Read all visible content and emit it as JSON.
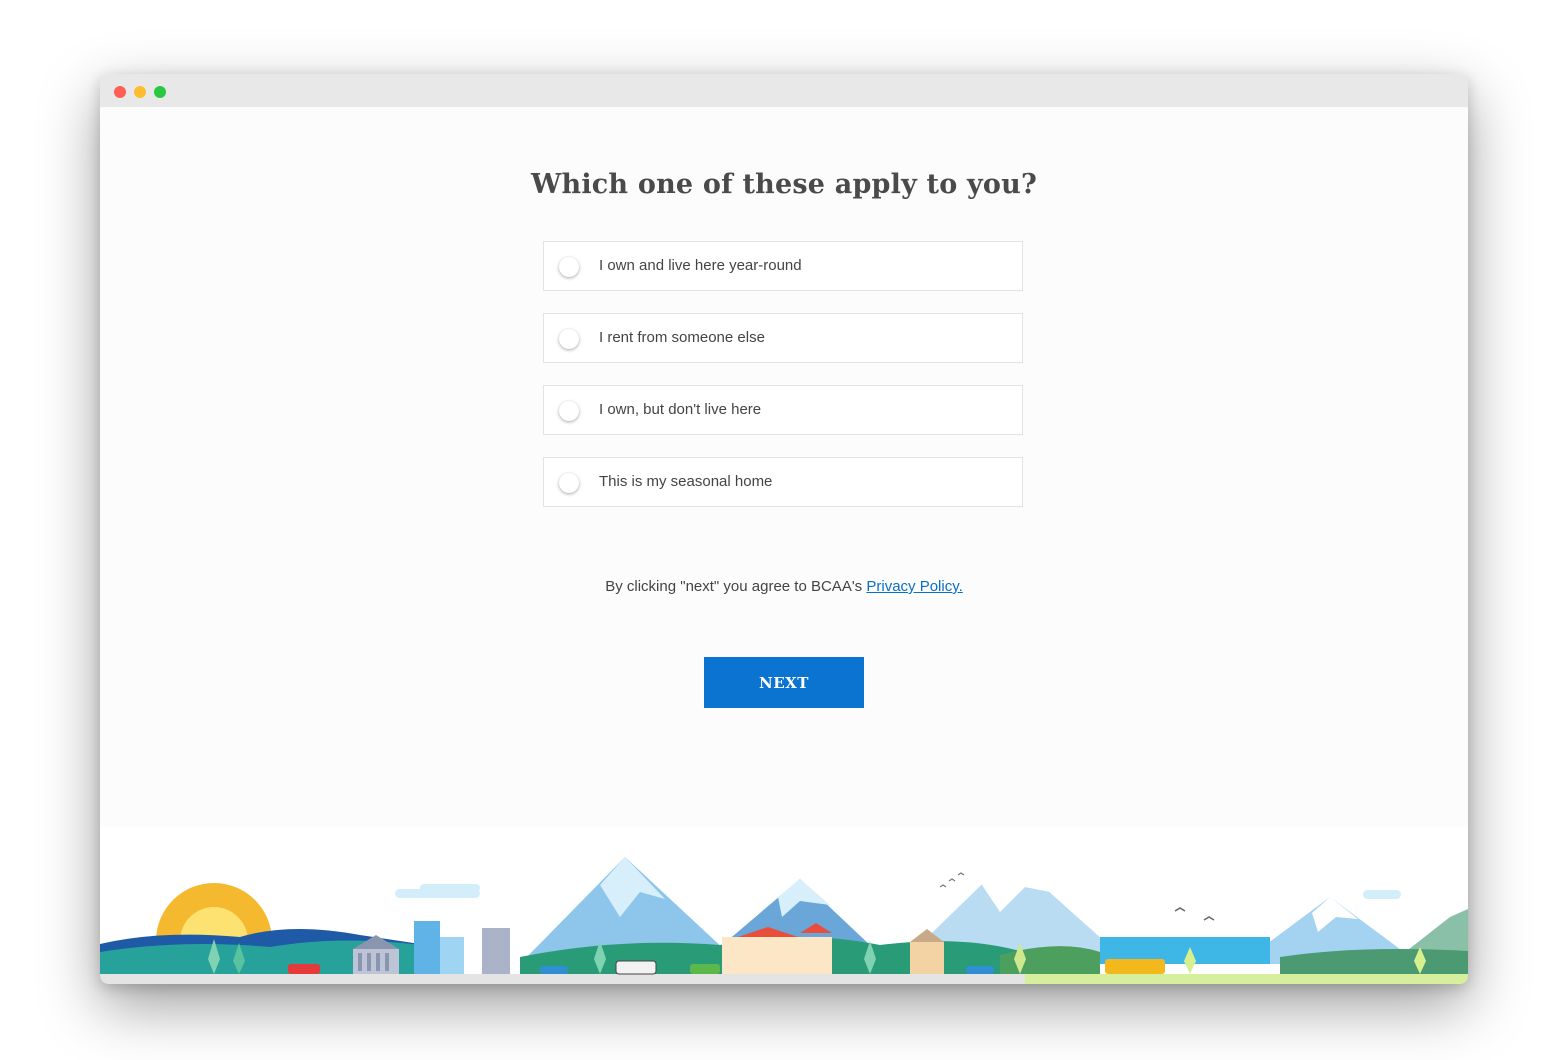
{
  "window": {
    "controls": {
      "close_color": "#fe5f57",
      "minimize_color": "#febc2e",
      "maximize_color": "#28c840"
    }
  },
  "form": {
    "question": "Which one of these apply to you?",
    "options": [
      {
        "label": "I own and live here year-round",
        "selected": false
      },
      {
        "label": "I rent from someone else",
        "selected": false
      },
      {
        "label": "I own, but don't live here",
        "selected": false
      },
      {
        "label": "This is my seasonal home",
        "selected": false
      }
    ],
    "consent_text": "By clicking \"next\" you agree to BCAA's ",
    "privacy_link": "Privacy Policy.",
    "next_label": "NEXT"
  },
  "colors": {
    "accent": "#0b74d1",
    "link": "#0b6fc7",
    "text": "#444444"
  },
  "footer_illustration": {
    "scene": "landscape-illustration"
  }
}
